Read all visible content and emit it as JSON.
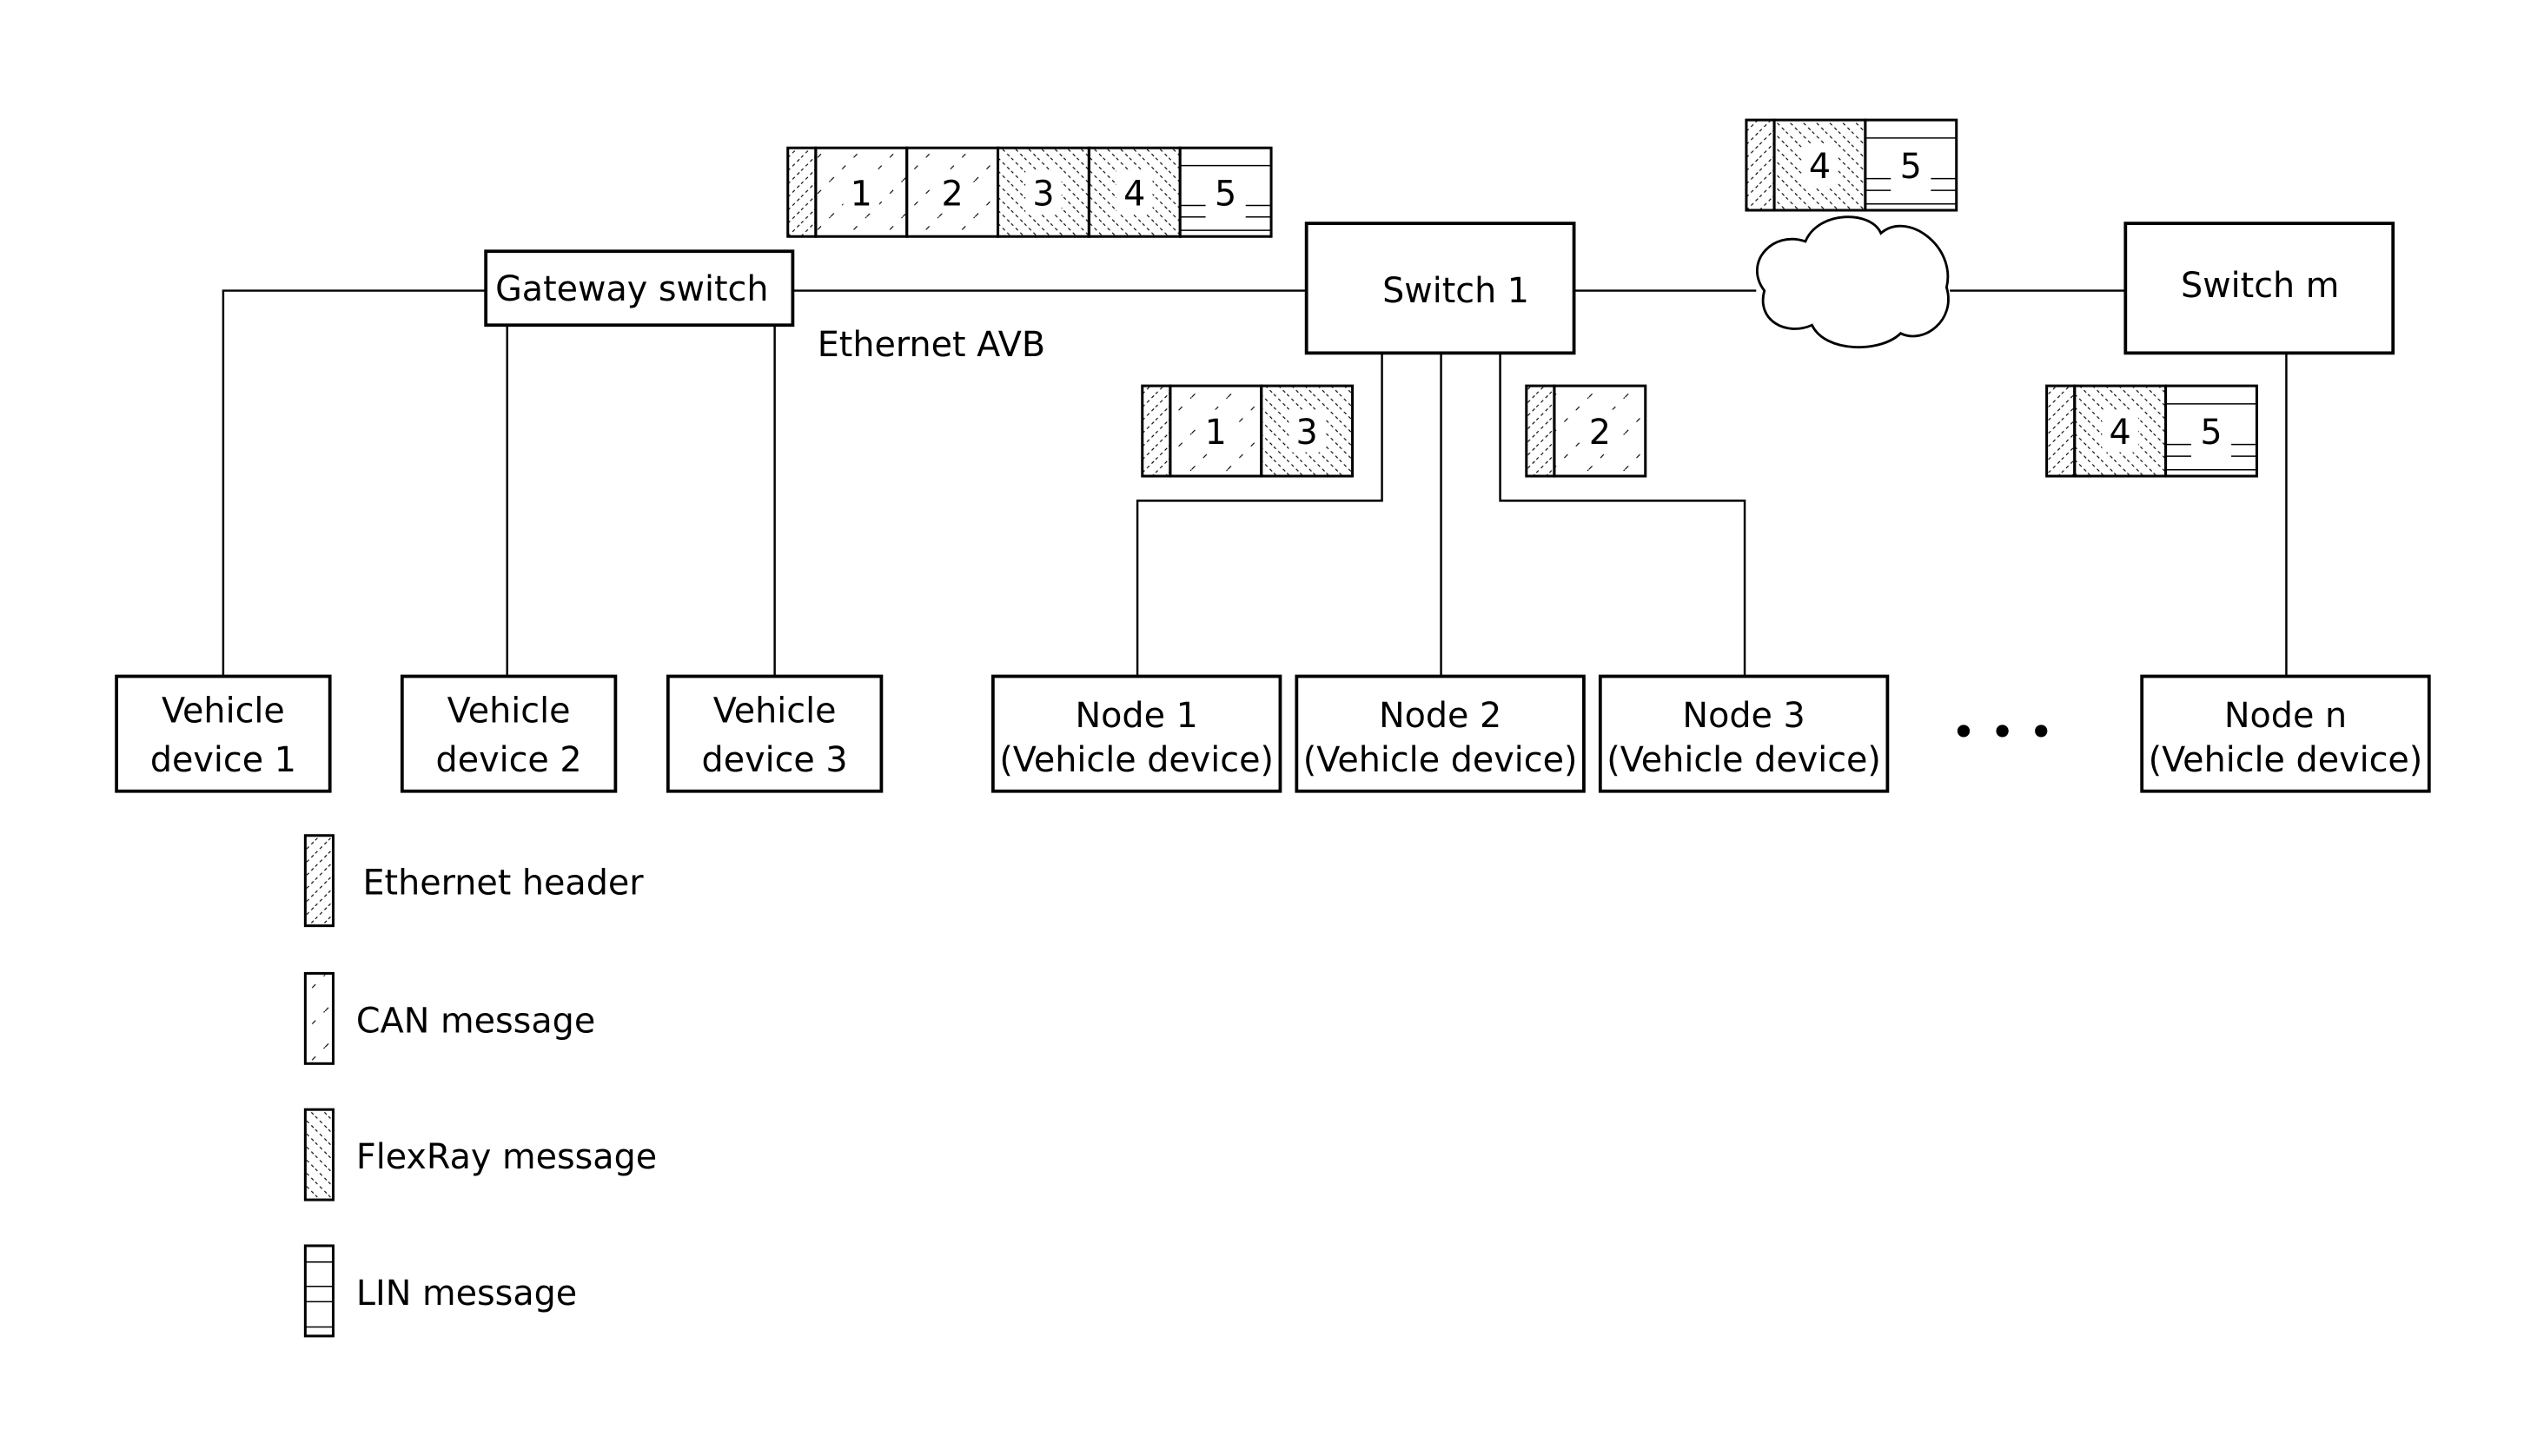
{
  "network": {
    "label": "Ethernet AVB",
    "gateway": "Gateway switch",
    "switch1": "Switch 1",
    "switchm": "Switch m",
    "ellipsis": "• • •"
  },
  "devices": [
    {
      "line1": "Vehicle",
      "line2": "device 1"
    },
    {
      "line1": "Vehicle",
      "line2": "device 2"
    },
    {
      "line1": "Vehicle",
      "line2": "device 3"
    }
  ],
  "nodes": [
    {
      "line1": "Node 1",
      "line2": "(Vehicle device)"
    },
    {
      "line1": "Node 2",
      "line2": "(Vehicle device)"
    },
    {
      "line1": "Node 3",
      "line2": "(Vehicle device)"
    },
    {
      "line1": "Node n",
      "line2": "(Vehicle device)"
    }
  ],
  "frames": {
    "main": {
      "cells": [
        {
          "type": "can",
          "label": "1"
        },
        {
          "type": "can",
          "label": "2"
        },
        {
          "type": "flexray",
          "label": "3"
        },
        {
          "type": "flexray",
          "label": "4"
        },
        {
          "type": "lin",
          "label": "5"
        }
      ]
    },
    "cloud": {
      "cells": [
        {
          "type": "flexray",
          "label": "4"
        },
        {
          "type": "lin",
          "label": "5"
        }
      ]
    },
    "node1": {
      "cells": [
        {
          "type": "can",
          "label": "1"
        },
        {
          "type": "flexray",
          "label": "3"
        }
      ]
    },
    "node3": {
      "cells": [
        {
          "type": "can",
          "label": "2"
        }
      ]
    },
    "noden": {
      "cells": [
        {
          "type": "flexray",
          "label": "4"
        },
        {
          "type": "lin",
          "label": "5"
        }
      ]
    }
  },
  "legend": [
    {
      "type": "eth",
      "label": "Ethernet header"
    },
    {
      "type": "can",
      "label": "CAN message"
    },
    {
      "type": "flexray",
      "label": "FlexRay message"
    },
    {
      "type": "lin",
      "label": "LIN message"
    }
  ]
}
